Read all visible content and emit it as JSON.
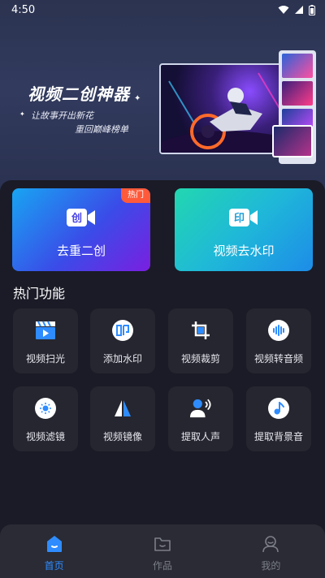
{
  "status_bar": {
    "time": "4:50"
  },
  "banner": {
    "title": "视频二创神器",
    "subtitle_line1": "让故事开出新花",
    "subtitle_line2": "重回巅峰榜单"
  },
  "feature_cards": [
    {
      "label": "去重二创",
      "badge": "热门",
      "icon_text": "创",
      "icon": "video-create-icon"
    },
    {
      "label": "视频去水印",
      "icon_text": "印",
      "icon": "video-watermark-icon"
    }
  ],
  "section_title": "热门功能",
  "tools": [
    {
      "label": "视频扫光",
      "icon": "video-clapper-icon"
    },
    {
      "label": "添加水印",
      "icon": "watermark-icon"
    },
    {
      "label": "视频裁剪",
      "icon": "crop-icon"
    },
    {
      "label": "视频转音频",
      "icon": "audio-wave-icon"
    },
    {
      "label": "视频滤镜",
      "icon": "filter-icon"
    },
    {
      "label": "视频镜像",
      "icon": "mirror-icon"
    },
    {
      "label": "提取人声",
      "icon": "voice-icon"
    },
    {
      "label": "提取背景音",
      "icon": "music-note-icon"
    }
  ],
  "tabs": [
    {
      "label": "首页",
      "icon": "home-icon",
      "active": true
    },
    {
      "label": "作品",
      "icon": "folder-icon",
      "active": false
    },
    {
      "label": "我的",
      "icon": "profile-icon",
      "active": false
    }
  ],
  "colors": {
    "accent": "#2f8cff",
    "hot_badge": "#ff5a3a",
    "panel": "#1a1b26"
  }
}
